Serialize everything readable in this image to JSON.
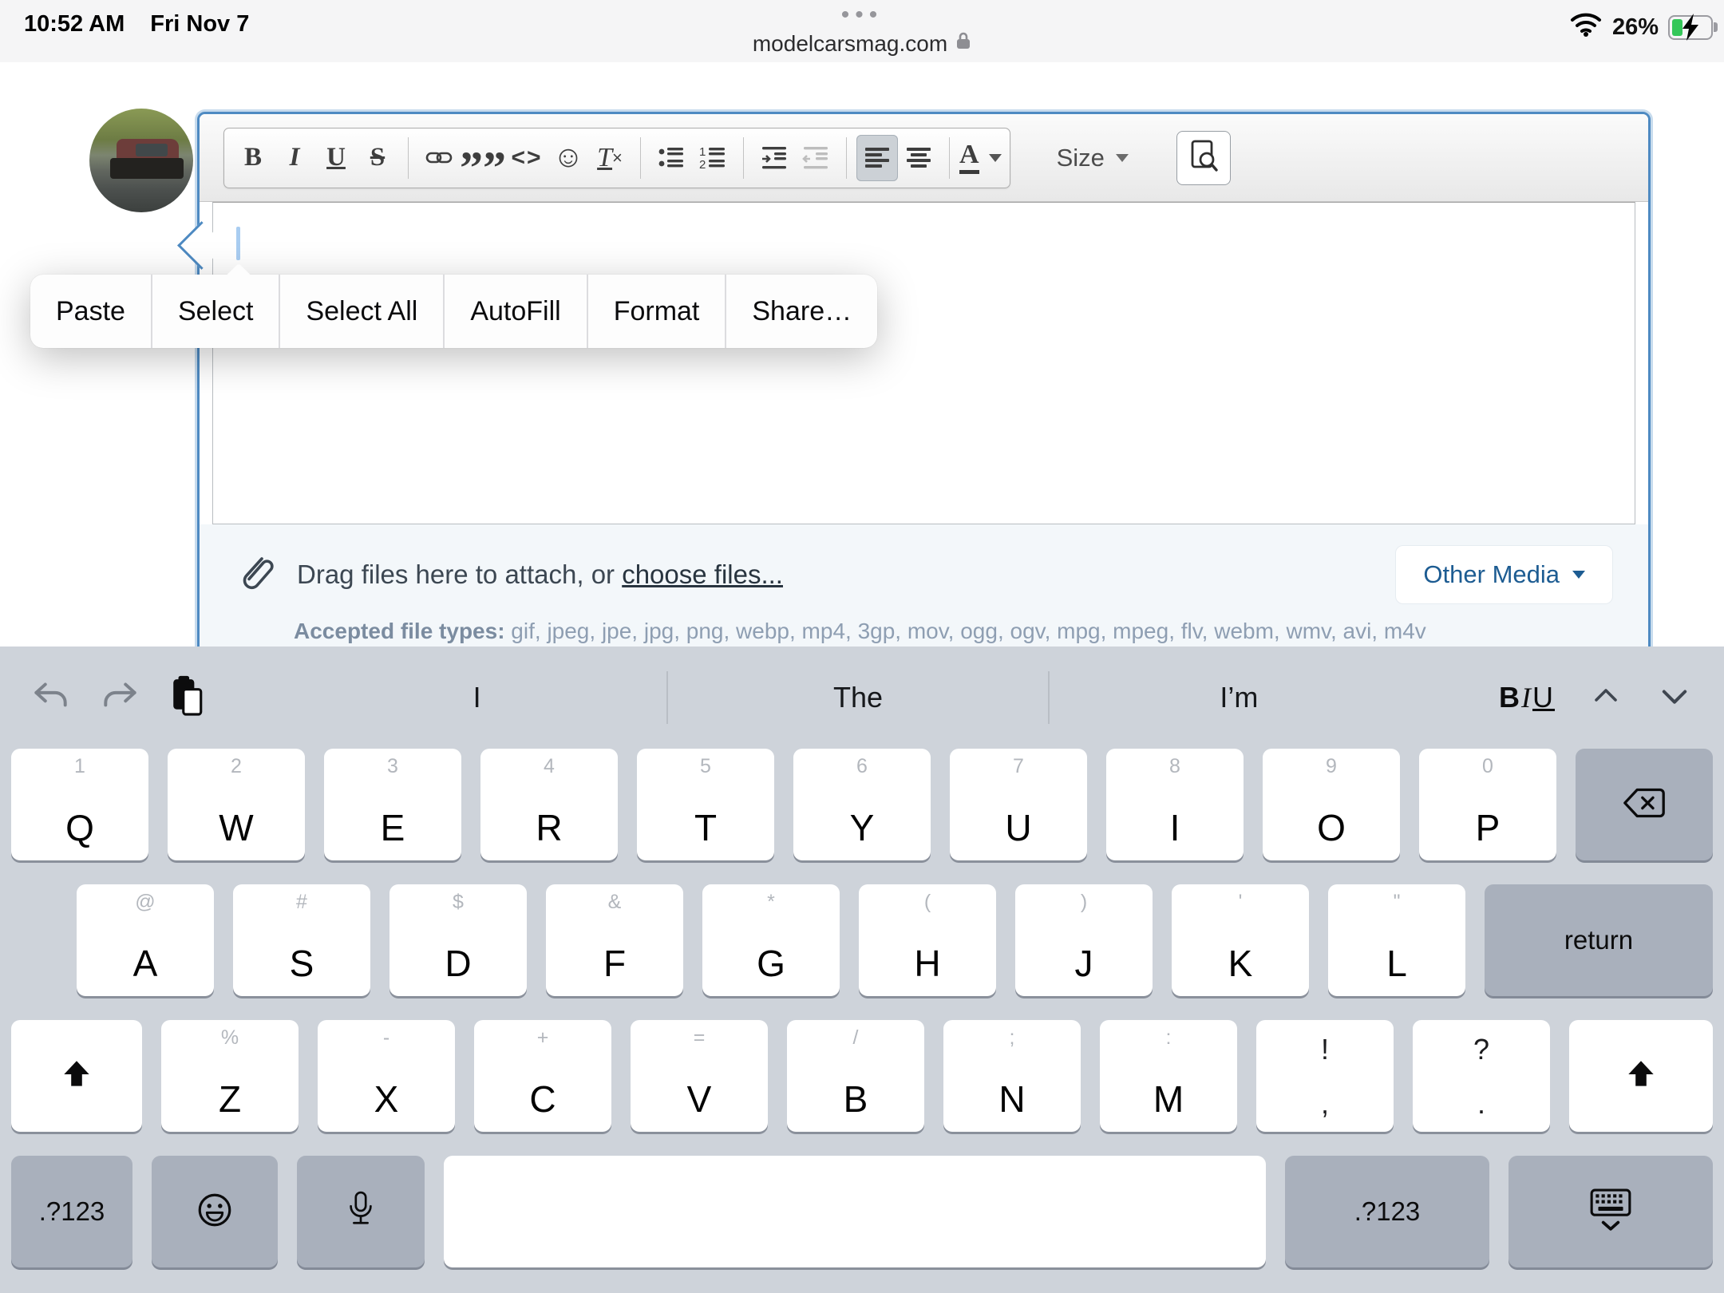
{
  "status_bar": {
    "time": "10:52 AM",
    "date": "Fri Nov 7",
    "ellipsis": "•••",
    "domain": "modelcarsmag.com",
    "battery_percent": "26%",
    "battery_color": "#34c759"
  },
  "editor": {
    "toolbar": {
      "bold": "B",
      "italic": "I",
      "underline": "U",
      "strike": "S",
      "code": "<>",
      "emoji": "☺",
      "remove_format_t": "T",
      "remove_format_x": "×",
      "quote": "”",
      "font_color": "A",
      "size_label": "Size"
    },
    "context_menu": {
      "items": [
        "Paste",
        "Select",
        "Select All",
        "AutoFill",
        "Format",
        "Share…"
      ]
    },
    "attach": {
      "drag_prefix": "Drag files here to attach, or",
      "choose_link": "choose files...",
      "accepted_label": "Accepted file types:",
      "accepted_types": " gif, jpeg, jpe, jpg, png, webp, mp4, 3gp, mov, ogg, ogv, mpg, mpeg, flv, webm, wmv, avi, m4v",
      "other_media": "Other Media"
    }
  },
  "suggestion_bar": {
    "predictions": [
      "I",
      "The",
      "I’m"
    ],
    "format_b": "B",
    "format_i": "I",
    "format_u": "U"
  },
  "keyboard": {
    "rows": [
      [
        {
          "p": "Q",
          "h": "1"
        },
        {
          "p": "W",
          "h": "2"
        },
        {
          "p": "E",
          "h": "3"
        },
        {
          "p": "R",
          "h": "4"
        },
        {
          "p": "T",
          "h": "5"
        },
        {
          "p": "Y",
          "h": "6"
        },
        {
          "p": "U",
          "h": "7"
        },
        {
          "p": "I",
          "h": "8"
        },
        {
          "p": "O",
          "h": "9"
        },
        {
          "p": "P",
          "h": "0"
        },
        {
          "special": "delete"
        }
      ],
      [
        {
          "p": "A",
          "h": "@"
        },
        {
          "p": "S",
          "h": "#"
        },
        {
          "p": "D",
          "h": "$"
        },
        {
          "p": "F",
          "h": "&"
        },
        {
          "p": "G",
          "h": "*"
        },
        {
          "p": "H",
          "h": "("
        },
        {
          "p": "J",
          "h": ")"
        },
        {
          "p": "K",
          "h": "'"
        },
        {
          "p": "L",
          "h": "\""
        },
        {
          "special": "return",
          "label": "return"
        }
      ],
      [
        {
          "special": "shift"
        },
        {
          "p": "Z",
          "h": "%"
        },
        {
          "p": "X",
          "h": "-"
        },
        {
          "p": "C",
          "h": "+"
        },
        {
          "p": "V",
          "h": "="
        },
        {
          "p": "B",
          "h": "/"
        },
        {
          "p": "N",
          "h": ";"
        },
        {
          "p": "M",
          "h": ":"
        },
        {
          "top": "!",
          "bottom": ","
        },
        {
          "top": "?",
          "bottom": "."
        },
        {
          "special": "shift"
        }
      ],
      [
        {
          "special": "sym",
          "label": ".?123"
        },
        {
          "special": "emoji"
        },
        {
          "special": "mic"
        },
        {
          "special": "space"
        },
        {
          "special": "sym",
          "label": ".?123",
          "variant": "wide"
        },
        {
          "special": "dismiss"
        }
      ]
    ]
  }
}
